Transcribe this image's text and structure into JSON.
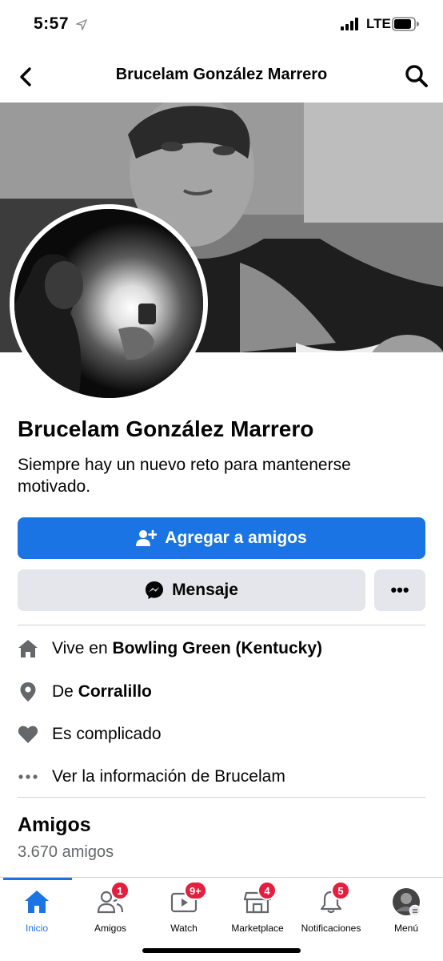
{
  "status_bar": {
    "time": "5:57",
    "network": "LTE"
  },
  "header": {
    "title": "Brucelam González Marrero"
  },
  "profile": {
    "name": "Brucelam González Marrero",
    "bio": "Siempre hay un nuevo reto para mantenerse motivado."
  },
  "actions": {
    "add_friend_label": "Agregar a amigos",
    "message_label": "Mensaje",
    "more_label": "•••"
  },
  "info": {
    "lives_prefix": "Vive en ",
    "lives_value": "Bowling Green (Kentucky)",
    "from_prefix": "De ",
    "from_value": "Corralillo",
    "relationship": "Es complicado",
    "see_info": "Ver la información de Brucelam"
  },
  "friends": {
    "title": "Amigos",
    "count": "3.670 amigos"
  },
  "tabs": [
    {
      "label": "Inicio",
      "icon": "home-icon",
      "active": true
    },
    {
      "label": "Amigos",
      "icon": "friends-icon",
      "badge": "1"
    },
    {
      "label": "Watch",
      "icon": "watch-icon",
      "badge": "9+"
    },
    {
      "label": "Marketplace",
      "icon": "marketplace-icon",
      "badge": "4"
    },
    {
      "label": "Notificaciones",
      "icon": "bell-icon",
      "badge": "5"
    },
    {
      "label": "Menú",
      "icon": "menu-avatar-icon"
    }
  ],
  "colors": {
    "accent": "#1b74e4",
    "badge": "#e41e3f",
    "secondary_button": "#e4e6eb"
  }
}
